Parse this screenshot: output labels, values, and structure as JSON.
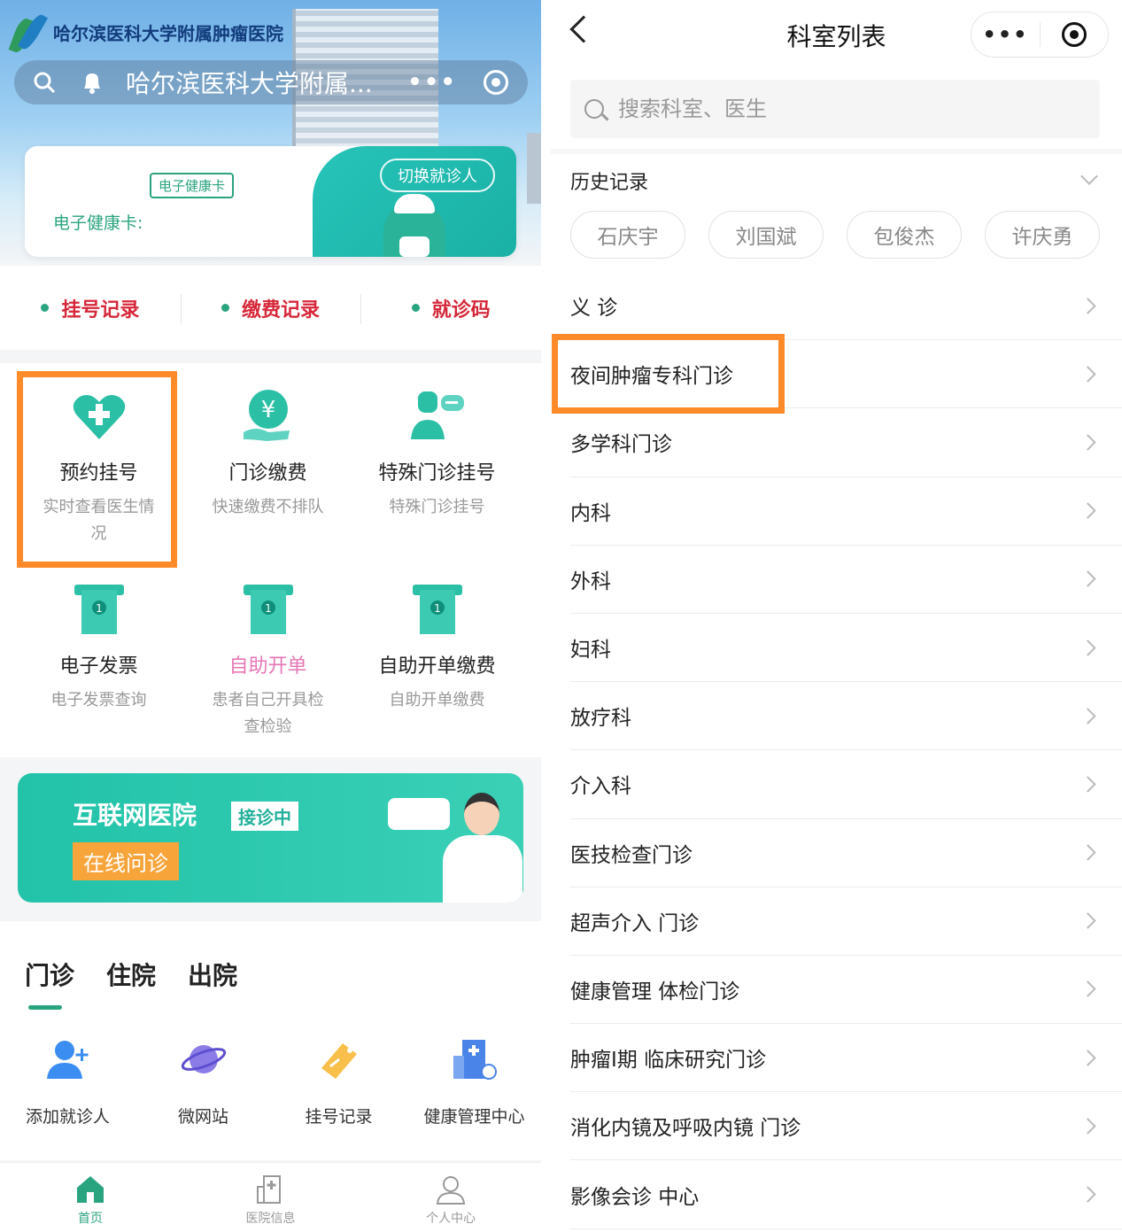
{
  "left": {
    "hospital_logo_text": "哈尔滨医科大学附属肿瘤医院",
    "capsule_title": "哈尔滨医科大学附属...",
    "capsule_more": "•••",
    "health_card": {
      "badge": "电子健康卡",
      "label": "电子健康卡:",
      "switch_btn": "切换就诊人"
    },
    "quick_links": [
      {
        "label": "挂号记录"
      },
      {
        "label": "缴费记录"
      },
      {
        "label": "就诊码"
      }
    ],
    "grid": [
      {
        "title": "预约挂号",
        "sub": "实时查看医生情况",
        "icon": "heart-plus-icon"
      },
      {
        "title": "门诊缴费",
        "sub": "快速缴费不排队",
        "icon": "yen-hand-icon"
      },
      {
        "title": "特殊门诊挂号",
        "sub": "特殊门诊挂号",
        "icon": "doctor-chat-icon"
      },
      {
        "title": "电子发票",
        "sub": "电子发票查询",
        "icon": "receipt-icon"
      },
      {
        "title": "自助开单",
        "sub": "患者自己开具检查检验",
        "icon": "receipt-icon"
      },
      {
        "title": "自助开单缴费",
        "sub": "自助开单缴费",
        "icon": "receipt-icon"
      }
    ],
    "banner": {
      "title": "互联网医院",
      "tag": "接诊中",
      "button": "在线问诊"
    },
    "tabs": [
      {
        "label": "门诊",
        "active": true
      },
      {
        "label": "住院",
        "active": false
      },
      {
        "label": "出院",
        "active": false
      }
    ],
    "services": [
      {
        "label": "添加就诊人",
        "icon": "add-user-icon"
      },
      {
        "label": "微网站",
        "icon": "planet-icon"
      },
      {
        "label": "挂号记录",
        "icon": "ticket-icon"
      },
      {
        "label": "健康管理中心",
        "icon": "hospital-building-icon"
      }
    ],
    "tabbar": [
      {
        "label": "首页",
        "icon": "home-icon",
        "active": true
      },
      {
        "label": "医院信息",
        "icon": "hospital-icon",
        "active": false
      },
      {
        "label": "个人中心",
        "icon": "user-icon",
        "active": false
      }
    ]
  },
  "right": {
    "nav_title": "科室列表",
    "nav_more": "•••",
    "search_placeholder": "搜索科室、医生",
    "history_title": "历史记录",
    "history": [
      "石庆宇",
      "刘国斌",
      "包俊杰",
      "许庆勇"
    ],
    "departments": [
      "义 诊",
      "夜间肿瘤专科门诊",
      "多学科门诊",
      "内科",
      "外科",
      "妇科",
      "放疗科",
      "介入科",
      "医技检查门诊",
      "超声介入 门诊",
      "健康管理 体检门诊",
      "肿瘤I期 临床研究门诊",
      "消化内镜及呼吸内镜 门诊",
      "影像会诊 中心"
    ]
  },
  "colors": {
    "accent": "#2aa47f",
    "highlight": "#ff8a2a",
    "quick_link_text": "#d6283a",
    "pink": "#e777b6"
  }
}
